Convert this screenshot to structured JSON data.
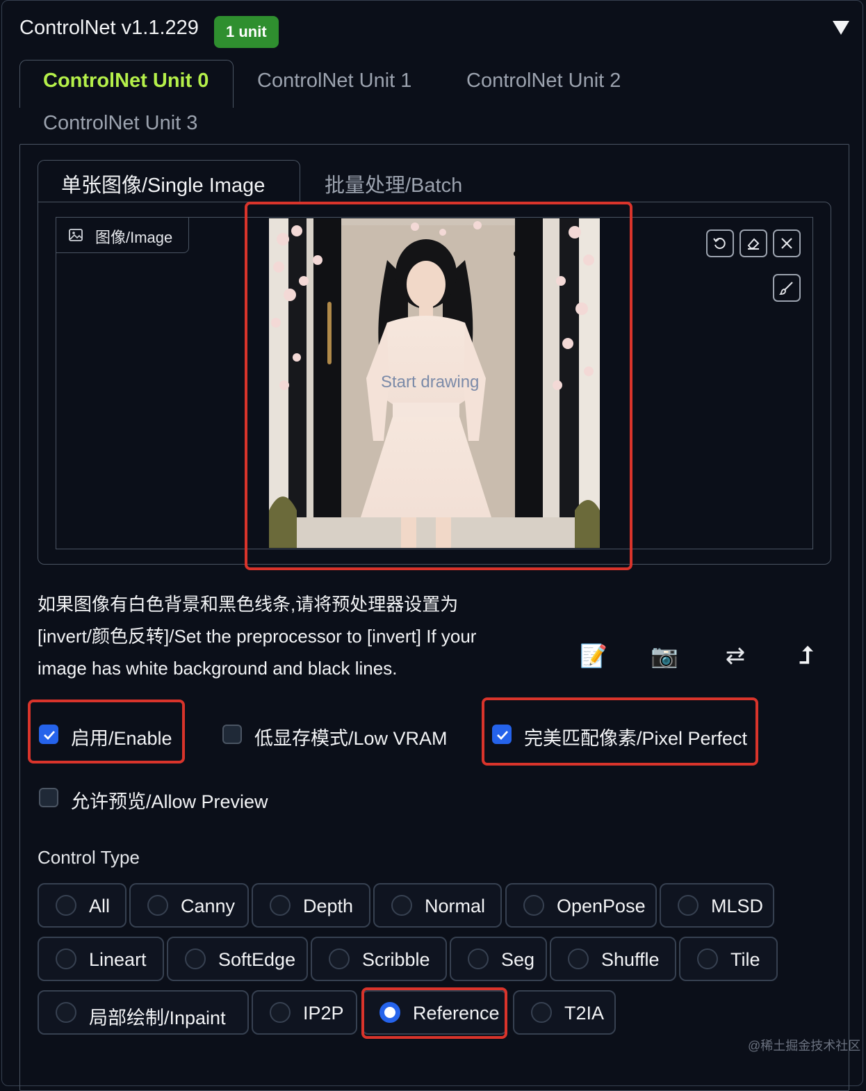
{
  "header": {
    "title": "ControlNet v1.1.229",
    "badge": "1 unit"
  },
  "unit_tabs": [
    "ControlNet Unit 0",
    "ControlNet Unit 1",
    "ControlNet Unit 2",
    "ControlNet Unit 3"
  ],
  "image_tabs": [
    "单张图像/Single Image",
    "批量处理/Batch"
  ],
  "image_panel": {
    "label": "图像/Image",
    "canvas_hint": "Start drawing",
    "tool_icons": [
      "undo-icon",
      "eraser-icon",
      "close-icon",
      "brush-icon"
    ]
  },
  "description": [
    "如果图像有白色背景和黑色线条,请将预处理器设置为",
    "[invert/颜色反转]/Set the preprocessor to [invert] If your",
    "image has white background and black lines."
  ],
  "action_icons": [
    "📝",
    "📷",
    "⇄",
    "⮥"
  ],
  "checkboxes": [
    {
      "label": "启用/Enable",
      "checked": true
    },
    {
      "label": "低显存模式/Low VRAM",
      "checked": false
    },
    {
      "label": "完美匹配像素/Pixel Perfect",
      "checked": true
    },
    {
      "label": "允许预览/Allow Preview",
      "checked": false
    }
  ],
  "control_type": {
    "label": "Control Type",
    "selected": "Reference",
    "options": [
      "All",
      "Canny",
      "Depth",
      "Normal",
      "OpenPose",
      "MLSD",
      "Lineart",
      "SoftEdge",
      "Scribble",
      "Seg",
      "Shuffle",
      "Tile",
      "局部绘制/Inpaint",
      "IP2P",
      "Reference",
      "T2IA"
    ]
  },
  "watermark": "@稀土掘金技术社区",
  "colors": {
    "background": "#0b0f19",
    "accent_green": "#b5f04a",
    "badge_green": "#2f8f2f",
    "checkbox_blue": "#2563eb",
    "highlight_red": "#d9342b"
  }
}
